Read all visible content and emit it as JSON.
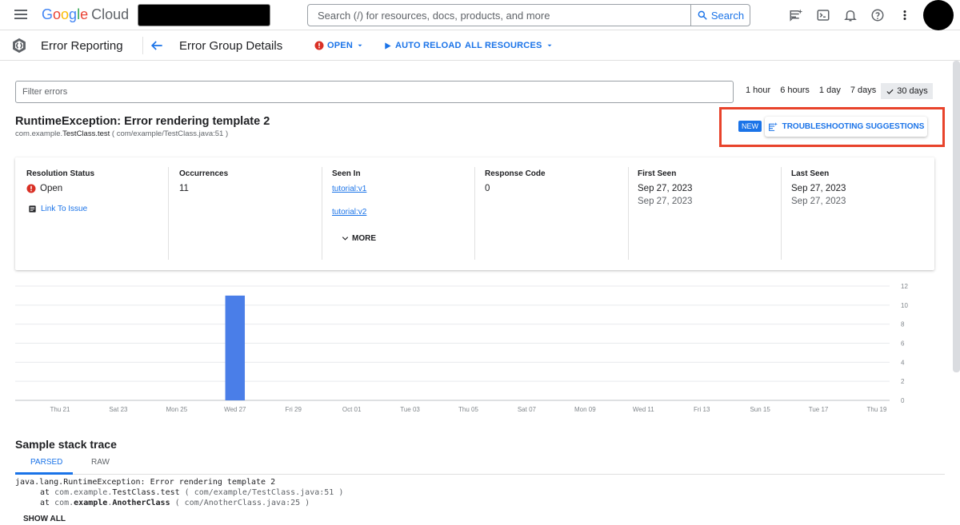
{
  "topbar": {
    "logo_letters": [
      "G",
      "o",
      "o",
      "g",
      "l",
      "e"
    ],
    "logo_product": "Cloud",
    "search_placeholder": "Search (/) for resources, docs, products, and more",
    "search_button": "Search",
    "icons": [
      "hamburger-icon",
      "gemini-icon",
      "terminal-icon",
      "bell-icon",
      "help-icon",
      "more-vert-icon"
    ]
  },
  "subheader": {
    "product": "Error Reporting",
    "page_title": "Error Group Details",
    "status_button": "OPEN",
    "auto_reload": "AUTO RELOAD",
    "resources": "ALL RESOURCES"
  },
  "filter": {
    "placeholder": "Filter errors"
  },
  "time_ranges": [
    {
      "label": "1 hour",
      "selected": false
    },
    {
      "label": "6 hours",
      "selected": false
    },
    {
      "label": "1 day",
      "selected": false
    },
    {
      "label": "7 days",
      "selected": false
    },
    {
      "label": "30 days",
      "selected": true
    }
  ],
  "error": {
    "title": "RuntimeException: Error rendering template 2",
    "location_prefix": "com.example.",
    "location_method": "TestClass.test",
    "location_file": " ( com/example/TestClass.java:51 )"
  },
  "troubleshooting": {
    "badge": "NEW",
    "label": "TROUBLESHOOTING SUGGESTIONS"
  },
  "details": {
    "resolution_status": {
      "header": "Resolution Status",
      "value": "Open",
      "link": "Link To Issue"
    },
    "occurrences": {
      "header": "Occurrences",
      "value": "11"
    },
    "seen_in": {
      "header": "Seen In",
      "links": [
        "tutorial:v1",
        "tutorial:v2"
      ],
      "more": "MORE"
    },
    "response_code": {
      "header": "Response Code",
      "value": "0"
    },
    "first_seen": {
      "header": "First Seen",
      "value": "Sep 27, 2023",
      "value2": "Sep 27, 2023"
    },
    "last_seen": {
      "header": "Last Seen",
      "value": "Sep 27, 2023",
      "value2": "Sep 27, 2023"
    }
  },
  "chart_data": {
    "type": "bar",
    "categories": [
      "Thu 21",
      "Sat 23",
      "Mon 25",
      "Wed 27",
      "Fri 29",
      "Oct 01",
      "Tue 03",
      "Thu 05",
      "Sat 07",
      "Mon 09",
      "Wed 11",
      "Fri 13",
      "Sun 15",
      "Tue 17",
      "Thu 19"
    ],
    "bars": [
      {
        "x": "Wed 27",
        "value": 11
      }
    ],
    "y_ticks": [
      0,
      2,
      4,
      6,
      8,
      10,
      12
    ],
    "ylim": [
      0,
      12
    ],
    "grid": true,
    "y_axis_side": "right",
    "bar_color": "#4a7ee8"
  },
  "stack_trace": {
    "title": "Sample stack trace",
    "tabs": [
      "PARSED",
      "RAW"
    ],
    "line1": "java.lang.RuntimeException: Error rendering template 2",
    "frames": [
      {
        "at": "at ",
        "prefix": "com.",
        "pkg": "example",
        "sep": ".",
        "method": "TestClass.test",
        "loc": " ( com/example/TestClass.java:51 )"
      },
      {
        "at": "at ",
        "prefix": "com.",
        "pkg": "example",
        "sep": ".",
        "method": "AnotherClass",
        "loc": " ( com/AnotherClass.java:25 )"
      }
    ],
    "show_all": "SHOW ALL"
  }
}
